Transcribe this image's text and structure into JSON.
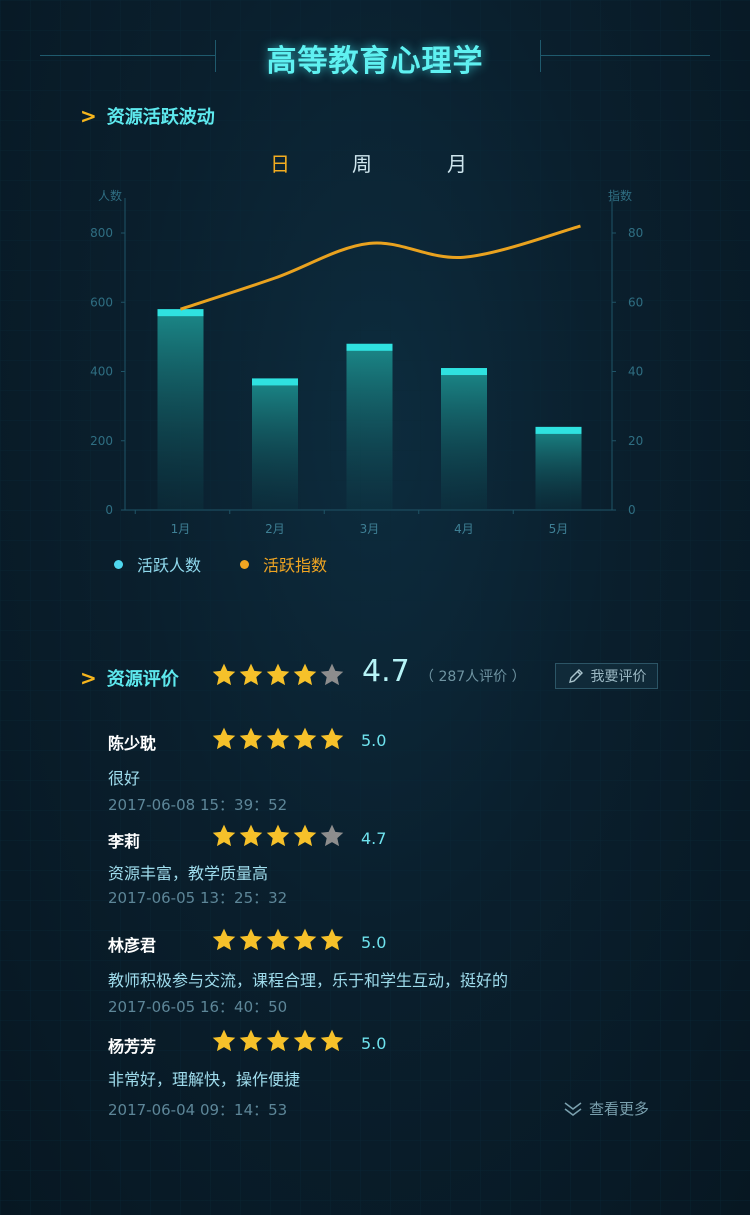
{
  "header": {
    "title": "高等教育心理学"
  },
  "activity": {
    "section_title": "资源活跃波动",
    "tabs": [
      "日",
      "周",
      "月"
    ],
    "active_tab": "日"
  },
  "chart_data": {
    "type": "bar",
    "categories": [
      "1月",
      "2月",
      "3月",
      "4月",
      "5月"
    ],
    "series": [
      {
        "name": "活跃人数",
        "type": "bar",
        "axis": "left",
        "values": [
          580,
          380,
          480,
          410,
          240
        ],
        "color": "#2fe2e0"
      },
      {
        "name": "活跃指数",
        "type": "line",
        "axis": "right",
        "values": [
          58,
          67,
          77,
          73,
          82
        ],
        "color": "#e9a21f"
      }
    ],
    "y_left": {
      "label": "人数",
      "ticks": [
        0,
        200,
        400,
        600,
        800
      ],
      "range": [
        0,
        800
      ]
    },
    "y_right": {
      "label": "指数",
      "ticks": [
        0,
        20,
        40,
        60,
        80
      ],
      "range": [
        0,
        80
      ]
    },
    "legend_placement": "bottom-left",
    "grid": false
  },
  "legend": [
    {
      "label": "活跃人数",
      "color": "#4fd7ee"
    },
    {
      "label": "活跃指数",
      "color": "#f0a522"
    }
  ],
  "rating": {
    "section_title": "资源评价",
    "average": "4.7",
    "stars": 4,
    "count_text": "（ 287人评价 ）",
    "rate_button": "我要评价"
  },
  "reviews": [
    {
      "name": "陈少耽",
      "stars": 5,
      "score": "5.0",
      "comment": "很好",
      "time": "2017-06-08 15：39：52"
    },
    {
      "name": "李莉",
      "stars": 4,
      "score": "4.7",
      "comment": "资源丰富，教学质量高",
      "time": "2017-06-05 13：25：32"
    },
    {
      "name": "林彦君",
      "stars": 5,
      "score": "5.0",
      "comment": "教师积极参与交流，课程合理，乐于和学生互动，挺好的",
      "time": "2017-06-05 16：40：50"
    },
    {
      "name": "杨芳芳",
      "stars": 5,
      "score": "5.0",
      "comment": "非常好，理解快，操作便捷",
      "time": "2017-06-04 09：14：53"
    }
  ],
  "more_label": "查看更多",
  "colors": {
    "accent": "#5ee9ee",
    "highlight": "#f3ad20",
    "star_on": "#f6c12a",
    "star_off": "#8d8d8d"
  }
}
